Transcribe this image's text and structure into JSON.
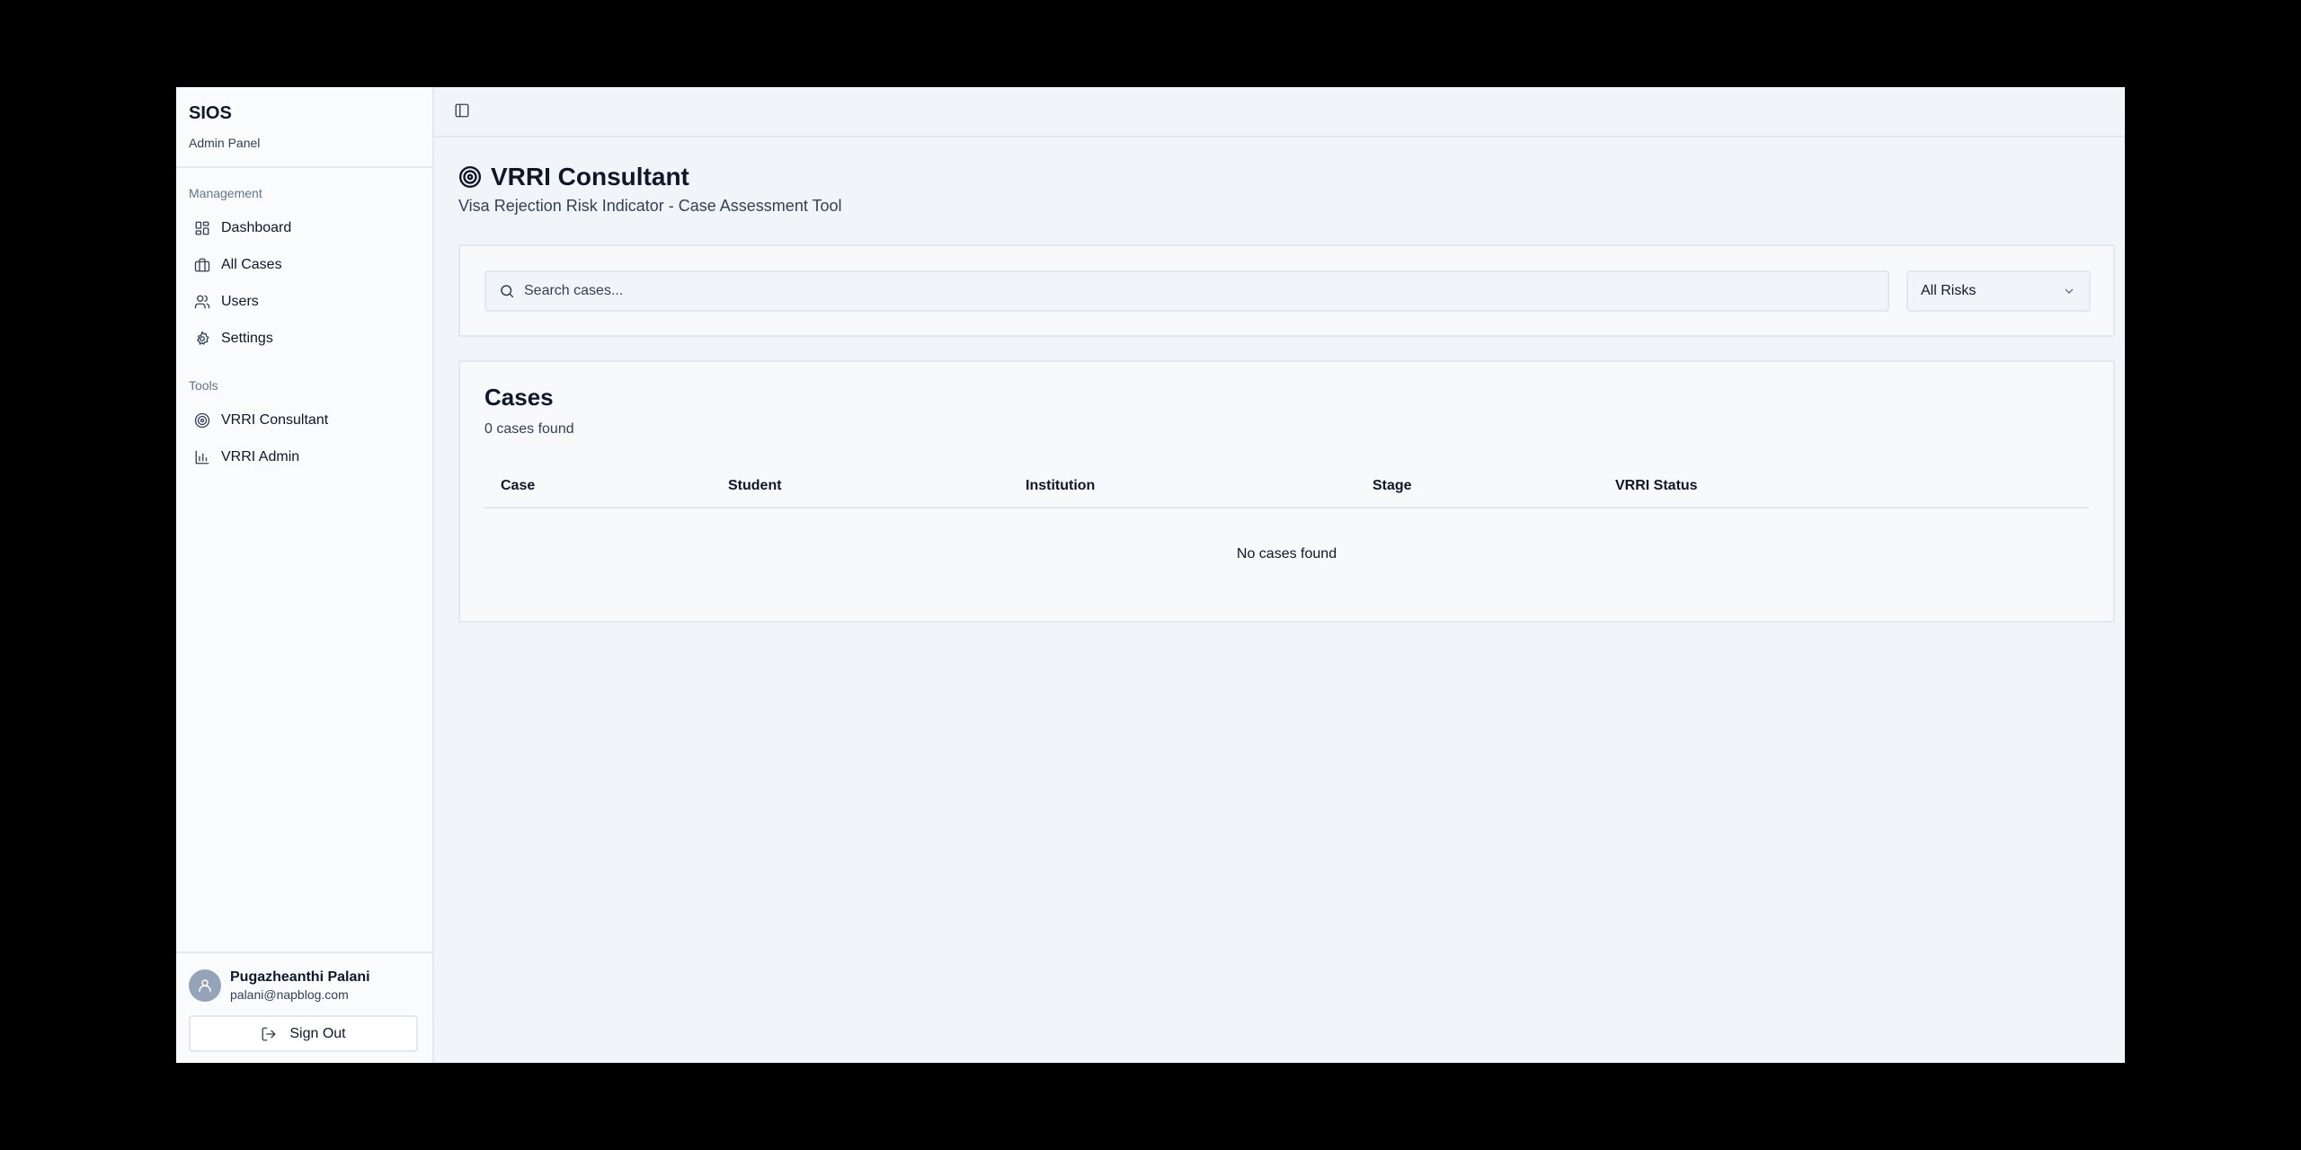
{
  "brand": {
    "title": "SIOS",
    "subtitle": "Admin Panel"
  },
  "sidebar": {
    "management_label": "Management",
    "management_items": [
      {
        "label": "Dashboard",
        "icon": "dashboard-icon"
      },
      {
        "label": "All Cases",
        "icon": "briefcase-icon"
      },
      {
        "label": "Users",
        "icon": "users-icon"
      },
      {
        "label": "Settings",
        "icon": "gear-icon"
      }
    ],
    "tools_label": "Tools",
    "tools_items": [
      {
        "label": "VRRI Consultant",
        "icon": "target-icon"
      },
      {
        "label": "VRRI Admin",
        "icon": "bar-chart-icon"
      }
    ]
  },
  "user": {
    "name": "Pugazheanthi Palani",
    "email": "palani@napblog.com",
    "signout_label": "Sign Out"
  },
  "page": {
    "title": "VRRI Consultant",
    "subtitle": "Visa Rejection Risk Indicator - Case Assessment Tool"
  },
  "search": {
    "placeholder": "Search cases...",
    "value": ""
  },
  "filter": {
    "selected": "All Risks"
  },
  "cases": {
    "title": "Cases",
    "count_text": "0 cases found",
    "columns": [
      "Case",
      "Student",
      "Institution",
      "Stage",
      "VRRI Status"
    ],
    "empty_text": "No cases found"
  }
}
